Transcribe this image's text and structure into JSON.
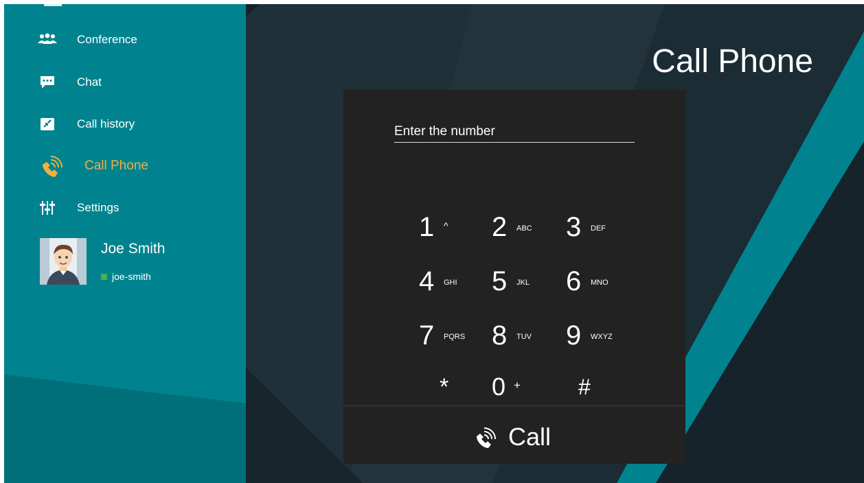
{
  "sidebar": {
    "items": [
      {
        "label": "Conference",
        "icon": "conference-icon"
      },
      {
        "label": "Chat",
        "icon": "chat-icon"
      },
      {
        "label": "Call history",
        "icon": "call-history-icon"
      },
      {
        "label": "Call Phone",
        "icon": "call-phone-icon"
      },
      {
        "label": "Settings",
        "icon": "settings-sliders-icon"
      }
    ],
    "active_index": 3
  },
  "profile": {
    "name": "Joe Smith",
    "handle": "joe-smith",
    "status": "online"
  },
  "main": {
    "title": "Call Phone"
  },
  "dialpad": {
    "placeholder": "Enter the number",
    "value": "",
    "keys": [
      {
        "digit": "1",
        "letters": "^"
      },
      {
        "digit": "2",
        "letters": "ABC"
      },
      {
        "digit": "3",
        "letters": "DEF"
      },
      {
        "digit": "4",
        "letters": "GHI"
      },
      {
        "digit": "5",
        "letters": "JKL"
      },
      {
        "digit": "6",
        "letters": "MNO"
      },
      {
        "digit": "7",
        "letters": "PQRS"
      },
      {
        "digit": "8",
        "letters": "TUV"
      },
      {
        "digit": "9",
        "letters": "WXYZ"
      },
      {
        "digit": "*",
        "letters": ""
      },
      {
        "digit": "0",
        "letters": "+"
      },
      {
        "digit": "#",
        "letters": ""
      }
    ],
    "call_label": "Call"
  },
  "colors": {
    "sidebar": "#00838f",
    "sidebar_dark": "#006f7a",
    "accent_active": "#f0b040",
    "background": "#1c2a31",
    "dialpad": "#222222",
    "teal_stripe": "#00838f",
    "status_online": "#4caf50"
  }
}
